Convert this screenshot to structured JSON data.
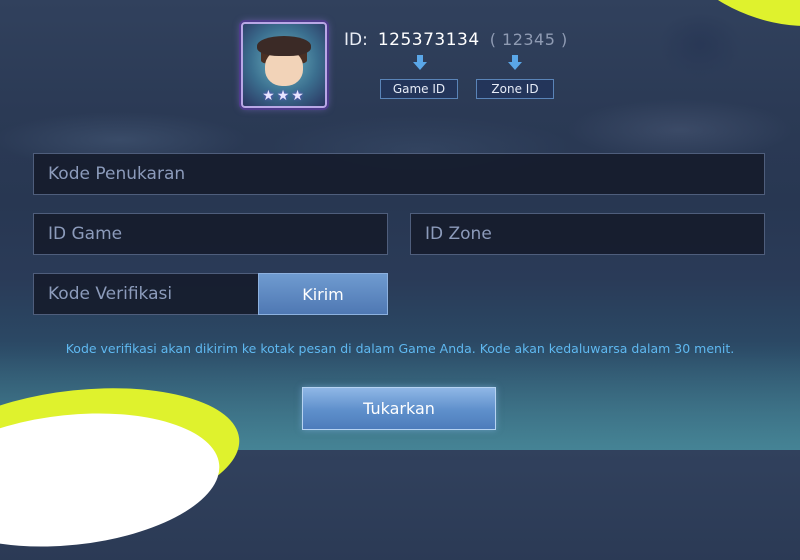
{
  "profile": {
    "id_label": "ID:",
    "game_id": "125373134",
    "zone_id": "( 12345 )",
    "game_id_tag": "Game ID",
    "zone_id_tag": "Zone ID",
    "avatar_icon": "hero-avatar"
  },
  "form": {
    "redeem_code_placeholder": "Kode Penukaran",
    "game_id_placeholder": "ID Game",
    "zone_id_placeholder": "ID Zone",
    "verification_placeholder": "Kode Verifikasi",
    "send_label": "Kirim",
    "notice": "Kode verifikasi akan dikirim ke kotak pesan di dalam Game Anda. Kode akan kedaluwarsa dalam 30 menit.",
    "redeem_label": "Tukarkan"
  },
  "colors": {
    "accent_lime": "#dff22d",
    "button_blue": "#5e8fcb",
    "notice_blue": "#5fb8f0"
  }
}
